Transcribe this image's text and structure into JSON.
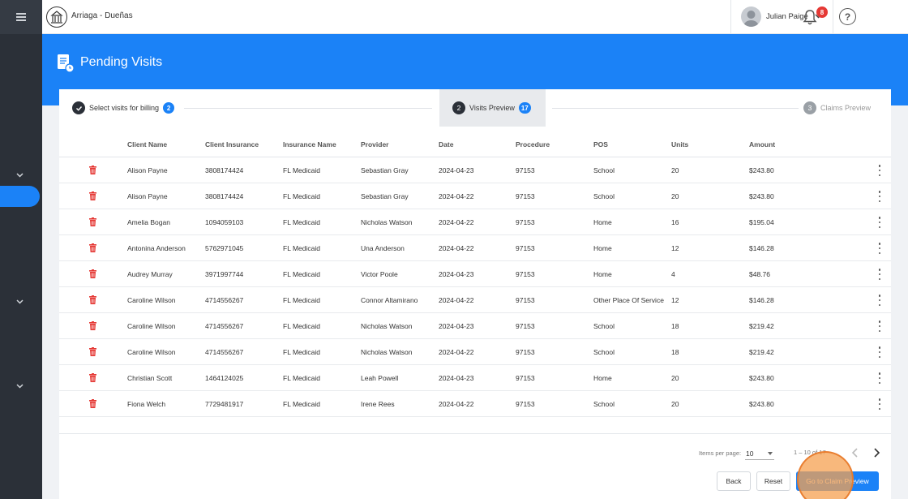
{
  "app": {
    "org_name": "Arriaga - Dueñas"
  },
  "user": {
    "name": "Julian Paige"
  },
  "notifications": {
    "count": "8"
  },
  "help": {
    "label": "?"
  },
  "page": {
    "title": "Pending Visits"
  },
  "stepper": {
    "steps": [
      {
        "number": "1",
        "label": "Select visits for billing",
        "count": "2",
        "state": "done"
      },
      {
        "number": "2",
        "label": "Visits Preview",
        "count": "17",
        "state": "active"
      },
      {
        "number": "3",
        "label": "Claims Preview",
        "count": "",
        "state": "pending"
      }
    ]
  },
  "table": {
    "columns": [
      "Client Name",
      "Client Insurance",
      "Insurance Name",
      "Provider",
      "Date",
      "Procedure",
      "POS",
      "Units",
      "Amount"
    ],
    "rows": [
      [
        "Alison Payne",
        "3808174424",
        "FL Medicaid",
        "Sebastian Gray",
        "2024-04-23",
        "97153",
        "School",
        "20",
        "$243.80"
      ],
      [
        "Alison Payne",
        "3808174424",
        "FL Medicaid",
        "Sebastian Gray",
        "2024-04-22",
        "97153",
        "School",
        "20",
        "$243.80"
      ],
      [
        "Amelia Bogan",
        "1094059103",
        "FL Medicaid",
        "Nicholas Watson",
        "2024-04-22",
        "97153",
        "Home",
        "16",
        "$195.04"
      ],
      [
        "Antonina Anderson",
        "5762971045",
        "FL Medicaid",
        "Una Anderson",
        "2024-04-22",
        "97153",
        "Home",
        "12",
        "$146.28"
      ],
      [
        "Audrey Murray",
        "3971997744",
        "FL Medicaid",
        "Victor Poole",
        "2024-04-23",
        "97153",
        "Home",
        "4",
        "$48.76"
      ],
      [
        "Caroline Wilson",
        "4714556267",
        "FL Medicaid",
        "Connor Altamirano",
        "2024-04-22",
        "97153",
        "Other Place Of Service",
        "12",
        "$146.28"
      ],
      [
        "Caroline Wilson",
        "4714556267",
        "FL Medicaid",
        "Nicholas Watson",
        "2024-04-23",
        "97153",
        "School",
        "18",
        "$219.42"
      ],
      [
        "Caroline Wilson",
        "4714556267",
        "FL Medicaid",
        "Nicholas Watson",
        "2024-04-22",
        "97153",
        "School",
        "18",
        "$219.42"
      ],
      [
        "Christian Scott",
        "1464124025",
        "FL Medicaid",
        "Leah Powell",
        "2024-04-23",
        "97153",
        "Home",
        "20",
        "$243.80"
      ],
      [
        "Fiona Welch",
        "7729481917",
        "FL Medicaid",
        "Irene Rees",
        "2024-04-22",
        "97153",
        "School",
        "20",
        "$243.80"
      ]
    ]
  },
  "pagination": {
    "items_per_page_label": "Items per page:",
    "items_per_page": "10",
    "range": "1 – 10 of 17"
  },
  "actions": {
    "back": "Back",
    "reset": "Reset",
    "next": "Go to Claim Preview"
  },
  "colors": {
    "primary": "#1b82f7",
    "sidebar": "#2b3038",
    "danger": "#e53935",
    "badge": "#e53935"
  }
}
